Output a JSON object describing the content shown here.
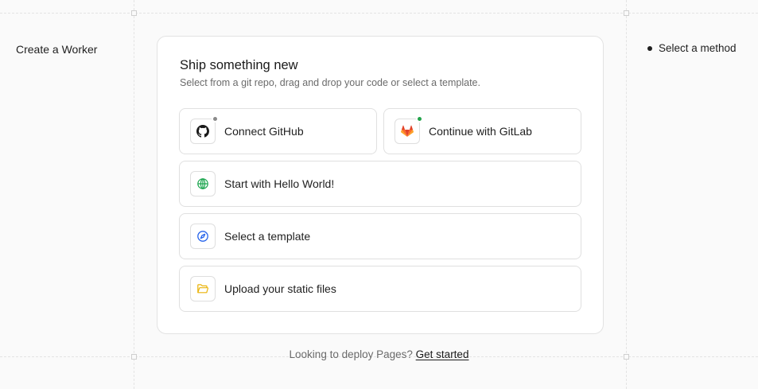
{
  "sidebar": {
    "title": "Create a Worker"
  },
  "steps": {
    "current": "Select a method"
  },
  "card": {
    "title": "Ship something new",
    "subtitle": "Select from a git repo, drag and drop your code or select a template.",
    "options": [
      {
        "label": "Connect GitHub",
        "icon": "github-icon",
        "status_color": "#8a8a8a"
      },
      {
        "label": "Continue with GitLab",
        "icon": "gitlab-icon",
        "status_color": "#22a34a"
      },
      {
        "label": "Start with Hello World!",
        "icon": "globe-icon"
      },
      {
        "label": "Select a template",
        "icon": "compass-icon"
      },
      {
        "label": "Upload your static files",
        "icon": "folder-open-icon"
      }
    ]
  },
  "footer": {
    "prompt": "Looking to deploy Pages?",
    "link": "Get started"
  },
  "colors": {
    "gitlab": "#e24329",
    "globe": "#16a34a",
    "compass": "#2563eb",
    "folder": "#eab308"
  }
}
